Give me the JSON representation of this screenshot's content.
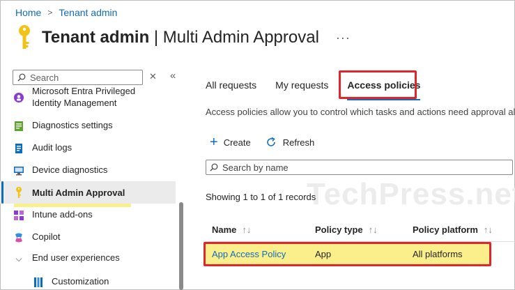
{
  "breadcrumb": {
    "home": "Home",
    "current": "Tenant admin"
  },
  "header": {
    "title_bold": "Tenant admin",
    "title_rest": "| Multi Admin Approval",
    "more": "···"
  },
  "sidebar": {
    "search_placeholder": "Search",
    "items": [
      {
        "label": "Microsoft Entra Privileged Identity Management",
        "icon": "privileged-identity-icon"
      },
      {
        "label": "Diagnostics settings",
        "icon": "diagnostics-icon"
      },
      {
        "label": "Audit logs",
        "icon": "audit-logs-icon"
      },
      {
        "label": "Device diagnostics",
        "icon": "device-diagnostics-icon"
      },
      {
        "label": "Multi Admin Approval",
        "icon": "key-icon",
        "active": true
      },
      {
        "label": "Intune add-ons",
        "icon": "add-ons-icon"
      },
      {
        "label": "Copilot",
        "icon": "copilot-icon"
      },
      {
        "label": "End user experiences",
        "icon": "chevron-down-icon"
      },
      {
        "label": "Customization",
        "icon": "customization-icon"
      }
    ]
  },
  "tabs": [
    {
      "label": "All requests"
    },
    {
      "label": "My requests"
    },
    {
      "label": "Access policies",
      "active": true
    }
  ],
  "description": "Access policies allow you to control which tasks and actions need approval alo",
  "toolbar": {
    "create": "Create",
    "refresh": "Refresh"
  },
  "filter": {
    "placeholder": "Search by name"
  },
  "records_text": "Showing 1 to 1 of 1 records",
  "watermark": "TechPress.net",
  "table": {
    "columns": [
      "Name",
      "Policy type",
      "Policy platform"
    ],
    "rows": [
      {
        "name": "App Access Policy",
        "type": "App",
        "platform": "All platforms"
      }
    ]
  },
  "colors": {
    "accent": "#0f6cbd",
    "highlight": "#faec78",
    "annotation_red": "#e0262a"
  }
}
